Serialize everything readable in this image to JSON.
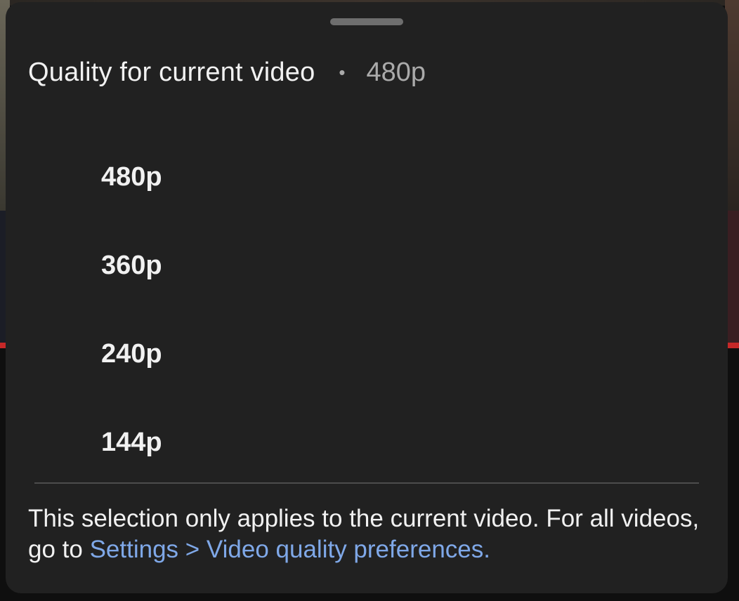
{
  "header": {
    "title": "Quality for current video",
    "separator": "•",
    "current_quality": "480p"
  },
  "options": [
    {
      "label": "480p"
    },
    {
      "label": "360p"
    },
    {
      "label": "240p"
    },
    {
      "label": "144p"
    }
  ],
  "footer": {
    "text": "This selection only applies to the current video. For all videos, go to",
    "link": "Settings > Video quality preferences."
  },
  "colors": {
    "sheet_background": "#212121",
    "primary_text": "#f1f1f1",
    "secondary_text": "#aaaaaa",
    "link": "#7fa8e8"
  }
}
